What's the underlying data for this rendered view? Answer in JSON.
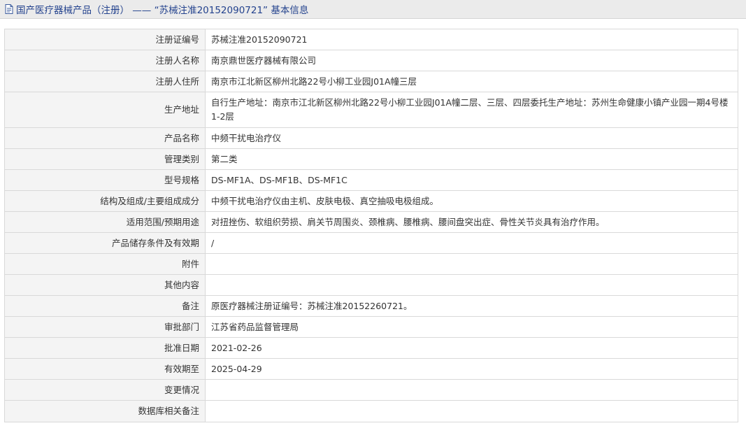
{
  "header": {
    "icon": "document-icon",
    "title": "国产医疗器械产品（注册） —— “苏械注准20152090721” 基本信息"
  },
  "colors": {
    "title_text": "#24438e",
    "title_bar_bg": "#ebebeb",
    "label_bg": "#f4f4f4",
    "border": "#d9d9d9"
  },
  "rows": [
    {
      "label": "注册证编号",
      "value": "苏械注准20152090721"
    },
    {
      "label": "注册人名称",
      "value": "南京鼎世医疗器械有限公司"
    },
    {
      "label": "注册人住所",
      "value": "南京市江北新区柳州北路22号小柳工业园J01A幢三层"
    },
    {
      "label": "生产地址",
      "value": "自行生产地址：南京市江北新区柳州北路22号小柳工业园J01A幢二层、三层、四层委托生产地址：苏州生命健康小镇产业园一期4号楼1-2层"
    },
    {
      "label": "产品名称",
      "value": "中频干扰电治疗仪"
    },
    {
      "label": "管理类别",
      "value": "第二类"
    },
    {
      "label": "型号规格",
      "value": "DS-MF1A、DS-MF1B、DS-MF1C"
    },
    {
      "label": "结构及组成/主要组成成分",
      "value": "中频干扰电治疗仪由主机、皮肤电极、真空抽吸电极组成。"
    },
    {
      "label": "适用范围/预期用途",
      "value": "对扭挫伤、软组织劳损、肩关节周围炎、颈椎病、腰椎病、腰间盘突出症、骨性关节炎具有治疗作用。"
    },
    {
      "label": "产品储存条件及有效期",
      "value": "/"
    },
    {
      "label": "附件",
      "value": ""
    },
    {
      "label": "其他内容",
      "value": ""
    },
    {
      "label": "备注",
      "value": "原医疗器械注册证编号：苏械注准20152260721。"
    },
    {
      "label": "审批部门",
      "value": "江苏省药品监督管理局"
    },
    {
      "label": "批准日期",
      "value": "2021-02-26"
    },
    {
      "label": "有效期至",
      "value": "2025-04-29"
    },
    {
      "label": "变更情况",
      "value": ""
    },
    {
      "label": "数据库相关备注",
      "value": ""
    }
  ]
}
